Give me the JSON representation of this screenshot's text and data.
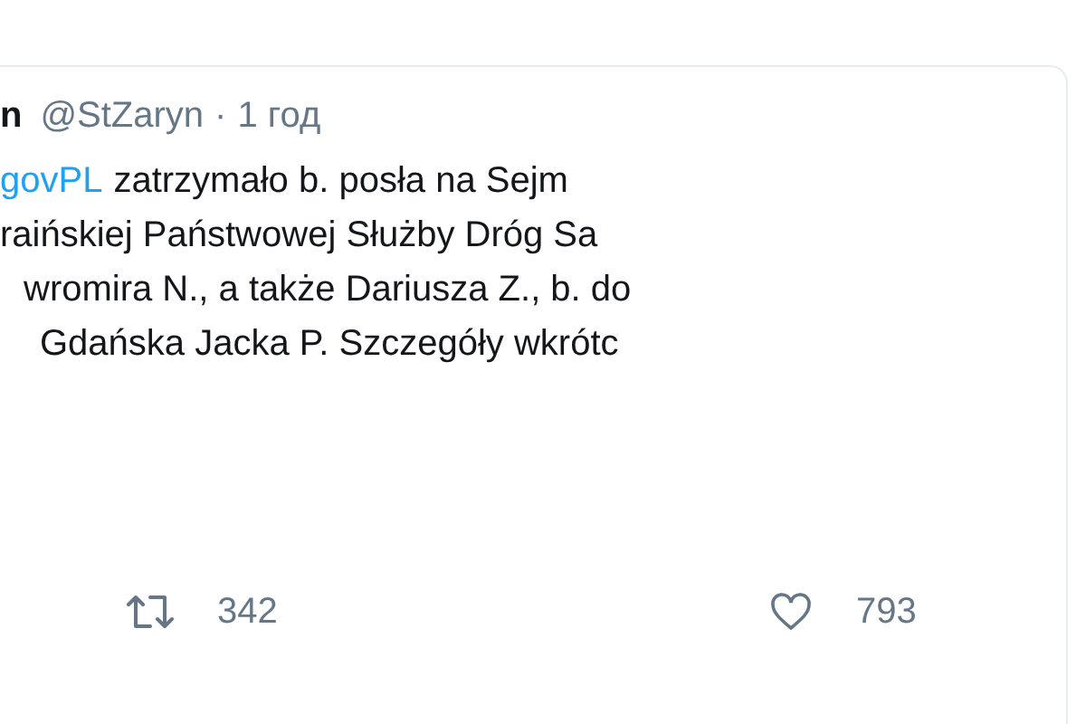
{
  "header": {
    "name": "n",
    "handle": "@StZaryn",
    "separator": "·",
    "time": "1 год"
  },
  "body": {
    "lines": [
      {
        "mention": "govPL",
        "text": "zatrzymało b. posła na Sejm"
      },
      {
        "text": "raińskiej Państwowej Służby Dróg Sa"
      },
      {
        "text": "wromira N., a także Dariusza Z., b. do"
      },
      {
        "text": "Gdańska Jacka P. Szczegóły wkrótc"
      }
    ]
  },
  "actions": [
    {
      "kind": "retweet",
      "count": "342"
    },
    {
      "kind": "like",
      "count": "793"
    }
  ]
}
